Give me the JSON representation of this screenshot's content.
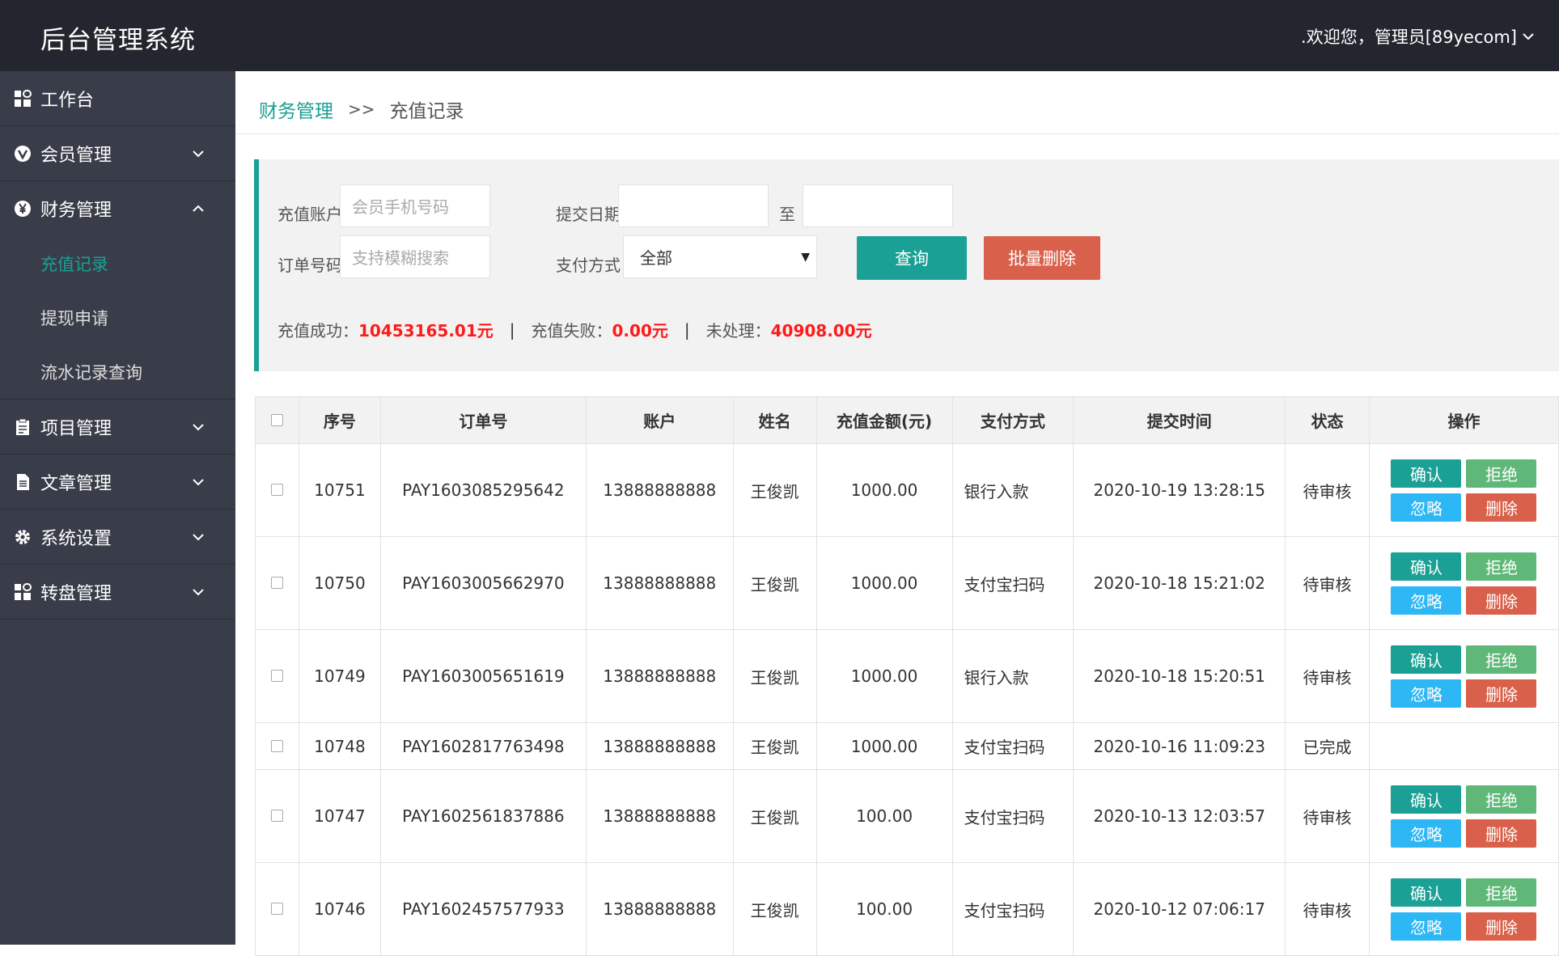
{
  "header": {
    "title": "后台管理系统",
    "user_greeting": ".欢迎您，管理员[89yecom]"
  },
  "sidebar": {
    "items": [
      {
        "label": "工作台",
        "icon": "dashboard-icon"
      },
      {
        "label": "会员管理",
        "icon": "vip-icon"
      },
      {
        "label": "财务管理",
        "icon": "yen-icon"
      },
      {
        "label": "项目管理",
        "icon": "clipboard-icon"
      },
      {
        "label": "文章管理",
        "icon": "document-icon"
      },
      {
        "label": "系统设置",
        "icon": "gear-icon"
      },
      {
        "label": "转盘管理",
        "icon": "grid-icon"
      }
    ],
    "finance_sub": [
      "充值记录",
      "提现申请",
      "流水记录查询"
    ]
  },
  "breadcrumb": {
    "root": "财务管理",
    "sep": ">>",
    "current": "充值记录"
  },
  "filter": {
    "account_label": "充值账户",
    "account_placeholder": "会员手机号码",
    "date_label": "提交日期",
    "date_to": "至",
    "order_label": "订单号码",
    "order_placeholder": "支持模糊搜索",
    "pay_label": "支付方式",
    "pay_selected": "全部",
    "query_btn": "查询",
    "batch_delete_btn": "批量删除"
  },
  "summary": {
    "success_label": "充值成功：",
    "success_value": "10453165.01元",
    "fail_label": "充值失败：",
    "fail_value": "0.00元",
    "pending_label": "未处理：",
    "pending_value": "40908.00元",
    "pipe": "|"
  },
  "table": {
    "headers": [
      "序号",
      "订单号",
      "账户",
      "姓名",
      "充值金额(元)",
      "支付方式",
      "提交时间",
      "状态",
      "操作"
    ],
    "op_labels": {
      "confirm": "确认",
      "reject": "拒绝",
      "ignore": "忽略",
      "delete": "删除"
    },
    "rows": [
      {
        "id": "10751",
        "order": "PAY1603085295642",
        "account": "13888888888",
        "name": "王俊凯",
        "amount": "1000.00",
        "pay": "银行入款",
        "time": "2020-10-19 13:28:15",
        "status": "待审核",
        "ops": true
      },
      {
        "id": "10750",
        "order": "PAY1603005662970",
        "account": "13888888888",
        "name": "王俊凯",
        "amount": "1000.00",
        "pay": "支付宝扫码",
        "time": "2020-10-18 15:21:02",
        "status": "待审核",
        "ops": true
      },
      {
        "id": "10749",
        "order": "PAY1603005651619",
        "account": "13888888888",
        "name": "王俊凯",
        "amount": "1000.00",
        "pay": "银行入款",
        "time": "2020-10-18 15:20:51",
        "status": "待审核",
        "ops": true
      },
      {
        "id": "10748",
        "order": "PAY1602817763498",
        "account": "13888888888",
        "name": "王俊凯",
        "amount": "1000.00",
        "pay": "支付宝扫码",
        "time": "2020-10-16 11:09:23",
        "status": "已完成",
        "ops": false
      },
      {
        "id": "10747",
        "order": "PAY1602561837886",
        "account": "13888888888",
        "name": "王俊凯",
        "amount": "100.00",
        "pay": "支付宝扫码",
        "time": "2020-10-13 12:03:57",
        "status": "待审核",
        "ops": true
      },
      {
        "id": "10746",
        "order": "PAY1602457577933",
        "account": "13888888888",
        "name": "王俊凯",
        "amount": "100.00",
        "pay": "支付宝扫码",
        "time": "2020-10-12 07:06:17",
        "status": "待审核",
        "ops": true
      }
    ]
  }
}
